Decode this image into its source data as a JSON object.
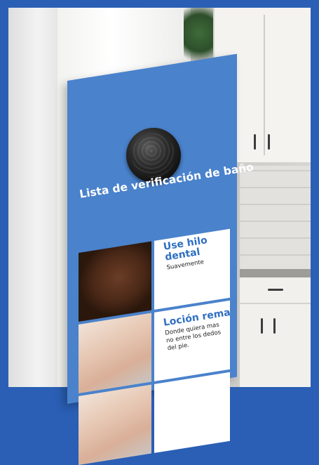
{
  "hanger": {
    "title": "Lista de verificación de baño",
    "items": [
      {
        "heading": "Use hilo dental",
        "detail": "Suavemente"
      },
      {
        "heading": "Loción rema",
        "detail": "Donde quiera mas no entre los dedos del pie."
      }
    ]
  },
  "colors": {
    "frame_border": "#2a5fb5",
    "hanger_blue": "#4a82cc",
    "heading_blue": "#2f6fc2"
  }
}
